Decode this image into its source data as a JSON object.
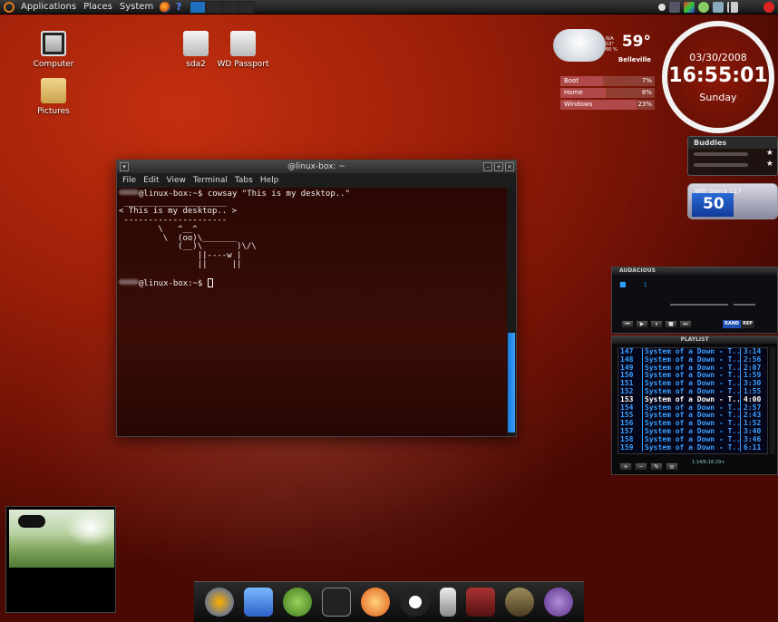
{
  "top_panel": {
    "menus": [
      "Applications",
      "Places",
      "System"
    ]
  },
  "desktop_icons": [
    {
      "label": "Computer"
    },
    {
      "label": "sda2"
    },
    {
      "label": "WD Passport"
    },
    {
      "label": "Pictures"
    }
  ],
  "terminal": {
    "title": "@linux-box: ~",
    "menu": [
      "File",
      "Edit",
      "View",
      "Terminal",
      "Tabs",
      "Help"
    ],
    "lines": [
      "@linux-box:~$ cowsay \"This is my desktop..\"",
      " _____________________",
      "< This is my desktop.. >",
      " ---------------------",
      "        \\   ^__^",
      "         \\  (oo)\\_______",
      "            (__)\\       )\\/\\",
      "                ||----w |",
      "                ||     ||",
      "@linux-box:~$ "
    ]
  },
  "weather": {
    "temp": "59°",
    "city": "Belleville",
    "details": [
      "N/A",
      "53°",
      "60 %"
    ]
  },
  "disk_meters": [
    {
      "label": "Boot",
      "percent": "7%",
      "value": 7
    },
    {
      "label": "Home",
      "percent": "8%",
      "value": 8
    },
    {
      "label": "Windows",
      "percent": "23%",
      "value": 23
    }
  ],
  "clock": {
    "date": "03/30/2008",
    "time": "16:55:01",
    "day": "Sunday"
  },
  "buddies": {
    "title": "Buddies"
  },
  "wifi": {
    "label": "Wifi Sierra 117",
    "value": "50"
  },
  "audacious": {
    "title": "AUDACIOUS",
    "buttons": [
      "⏮",
      "▶",
      "⏸",
      "■",
      "⏭"
    ],
    "toggles": [
      "RAND",
      "REP"
    ]
  },
  "playlist": {
    "title": "PLAYLIST",
    "rows": [
      {
        "n": "147",
        "title": "System of a Down - T...",
        "dur": "3:14"
      },
      {
        "n": "148",
        "title": "System of a Down - T...",
        "dur": "2:56"
      },
      {
        "n": "149",
        "title": "System of a Down - T...",
        "dur": "2:07"
      },
      {
        "n": "150",
        "title": "System of a Down - T...",
        "dur": "1:59"
      },
      {
        "n": "151",
        "title": "System of a Down - T...",
        "dur": "3:30"
      },
      {
        "n": "152",
        "title": "System of a Down - T...",
        "dur": "1:55"
      },
      {
        "n": "153",
        "title": "System of a Down - T...",
        "dur": "4:00",
        "current": true
      },
      {
        "n": "154",
        "title": "System of a Down - T...",
        "dur": "2:57"
      },
      {
        "n": "155",
        "title": "System of a Down - T...",
        "dur": "2:43"
      },
      {
        "n": "156",
        "title": "System of a Down - T...",
        "dur": "1:52"
      },
      {
        "n": "157",
        "title": "System of a Down - T...",
        "dur": "3:40"
      },
      {
        "n": "158",
        "title": "System of a Down - T...",
        "dur": "3:46"
      },
      {
        "n": "159",
        "title": "System of a Down - T...",
        "dur": "6:11"
      }
    ],
    "info": "1:14/6:16:29+",
    "buttons": [
      "+",
      "−",
      "✎",
      "≡"
    ]
  }
}
